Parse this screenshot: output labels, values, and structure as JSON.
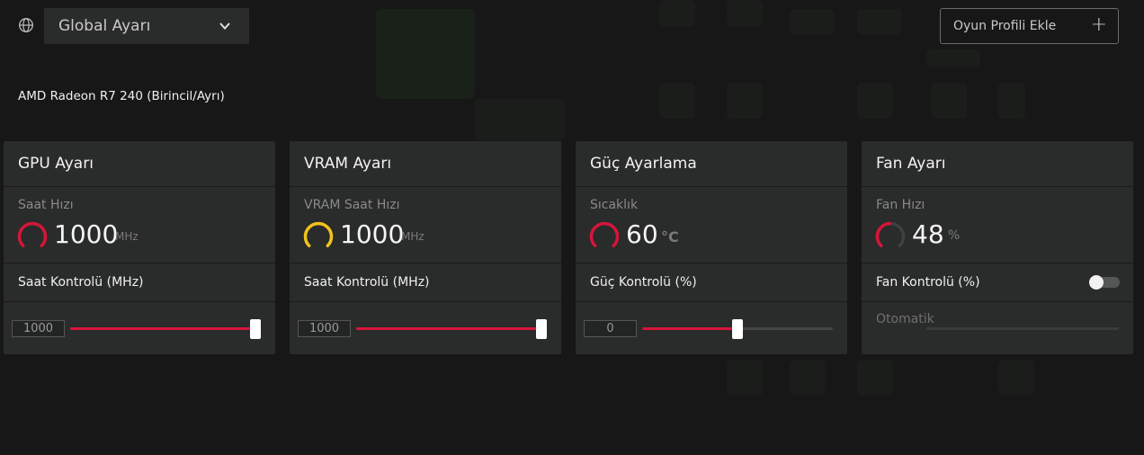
{
  "header": {
    "profile_select_value": "Global Ayarı",
    "add_profile_label": "Oyun Profili Ekle"
  },
  "gpu_name": "AMD Radeon R7 240 (Birincil/Ayrı)",
  "cards": [
    {
      "title": "GPU Ayarı",
      "metric_label": "Saat Hızı",
      "metric_value": "1000",
      "metric_unit": "MHz",
      "gauge_color": "#d6153a",
      "control_label": "Saat Kontrolü (MHz)",
      "input_value": "1000",
      "slider_fraction": 1.0
    },
    {
      "title": "VRAM Ayarı",
      "metric_label": "VRAM Saat Hızı",
      "metric_value": "1000",
      "metric_unit": "MHz",
      "gauge_color": "#f2c21b",
      "control_label": "Saat Kontrolü (MHz)",
      "input_value": "1000",
      "slider_fraction": 1.0
    },
    {
      "title": "Güç Ayarlama",
      "metric_label": "Sıcaklık",
      "metric_value": "60",
      "metric_unit": "°C",
      "gauge_color": "#d6153a",
      "control_label": "Güç Kontrolü (%)",
      "input_value": "0",
      "slider_fraction": 0.5
    },
    {
      "title": "Fan Ayarı",
      "metric_label": "Fan Hızı",
      "metric_value": "48",
      "metric_unit": "%",
      "gauge_color": "#d6153a",
      "gauge_fraction": 0.48,
      "control_label": "Fan Kontrolü (%)",
      "auto_label": "Otomatik",
      "toggle_on": false
    }
  ],
  "colors": {
    "accent": "#d6153a",
    "vram_gauge": "#f2c21b"
  },
  "icons": {
    "globe": "globe-icon",
    "dropdown": "chevron-down-icon",
    "add": "plus-icon"
  }
}
